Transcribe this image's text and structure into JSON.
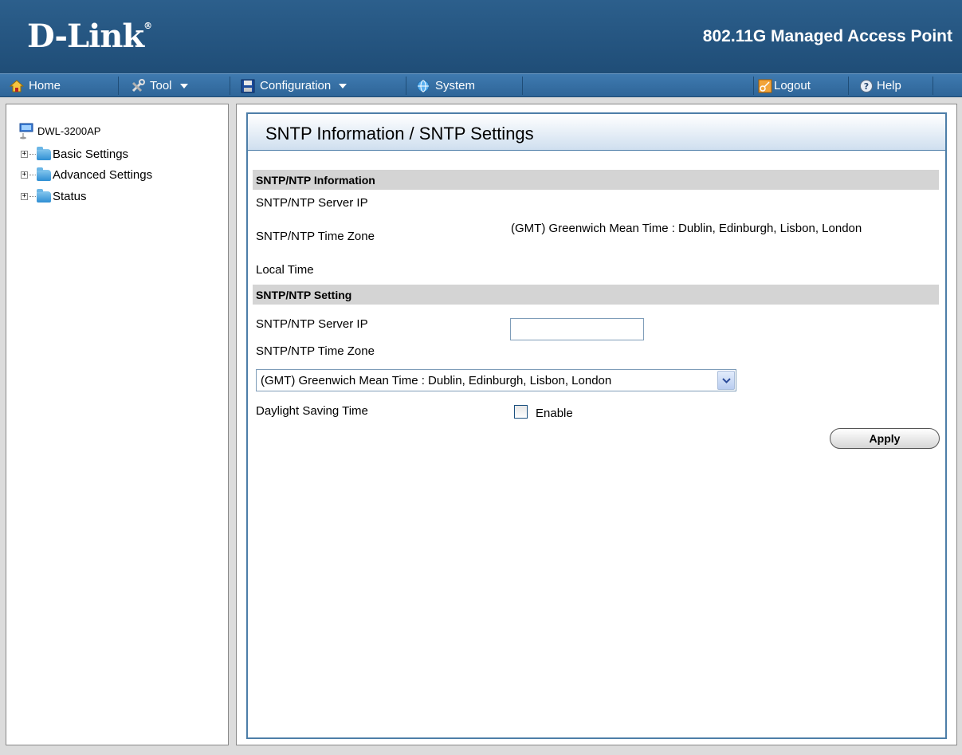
{
  "header": {
    "logo": "D-Link",
    "logo_mark": "®",
    "product_title": "802.11G Managed Access Point"
  },
  "menu": {
    "home": "Home",
    "tool": "Tool",
    "configuration": "Configuration",
    "system": "System",
    "logout": "Logout",
    "help": "Help"
  },
  "sidebar": {
    "root": "DWL-3200AP",
    "items": [
      {
        "label": "Basic Settings"
      },
      {
        "label": "Advanced Settings"
      },
      {
        "label": "Status"
      }
    ]
  },
  "main": {
    "title": "SNTP Information / SNTP Settings",
    "info_section": "SNTP/NTP Information",
    "info_server_ip_label": "SNTP/NTP Server IP",
    "info_time_zone_label": "SNTP/NTP Time Zone",
    "info_time_zone_value": "(GMT) Greenwich Mean Time : Dublin, Edinburgh, Lisbon, London",
    "local_time_label": "Local Time",
    "setting_section": "SNTP/NTP Setting",
    "setting_server_ip_label": "SNTP/NTP Server IP",
    "setting_server_ip_value": "",
    "setting_time_zone_label": "SNTP/NTP Time Zone",
    "time_zone_selected": "(GMT) Greenwich Mean Time : Dublin, Edinburgh, Lisbon, London",
    "dst_label": "Daylight Saving Time",
    "dst_enable_label": "Enable",
    "dst_enabled": false,
    "apply_label": "Apply"
  },
  "colors": {
    "header_blue": "#1f4d77",
    "menubar_blue": "#3f7ab0",
    "panel_border": "#4d7ea8",
    "section_gray": "#d4d4d4"
  }
}
